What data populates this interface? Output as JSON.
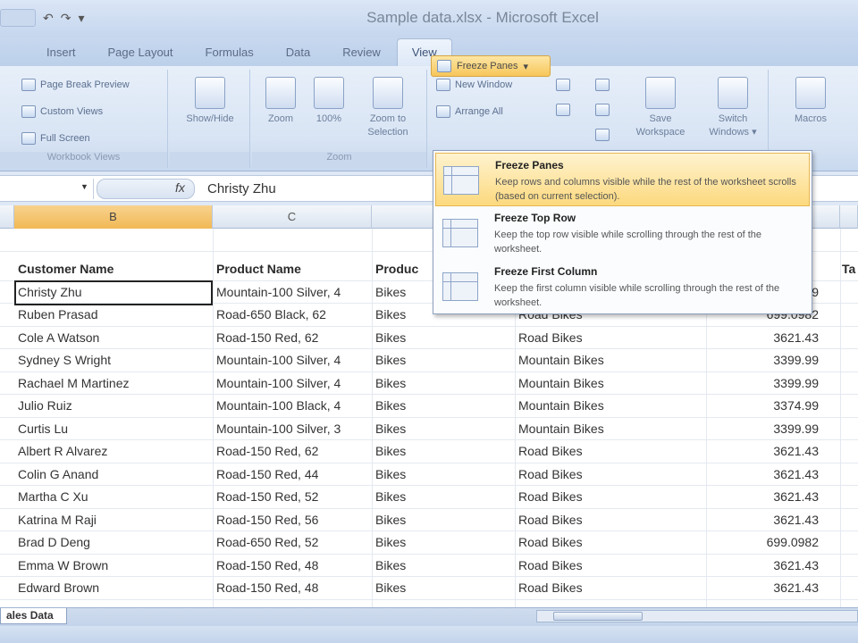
{
  "window": {
    "title": "Sample data.xlsx - Microsoft Excel"
  },
  "tabs": [
    {
      "label": "Insert"
    },
    {
      "label": "Page Layout"
    },
    {
      "label": "Formulas"
    },
    {
      "label": "Data"
    },
    {
      "label": "Review"
    },
    {
      "label": "View"
    }
  ],
  "ribbon": {
    "workbook_views": {
      "page_break": "Page Break Preview",
      "custom_views": "Custom Views",
      "full_screen": "Full Screen",
      "label": "Workbook Views"
    },
    "show_hide": "Show/Hide",
    "zoom": {
      "zoom": "Zoom",
      "hundred": "100%",
      "zoom_selection_1": "Zoom to",
      "zoom_selection_2": "Selection",
      "label": "Zoom"
    },
    "window": {
      "new_window": "New Window",
      "arrange_all": "Arrange All",
      "freeze_panes": "Freeze Panes",
      "save_workspace_1": "Save",
      "save_workspace_2": "Workspace",
      "switch_windows_1": "Switch",
      "switch_windows_2": "Windows"
    },
    "macros": "Macros"
  },
  "formula_bar": {
    "fx": "fx",
    "value": "Christy  Zhu"
  },
  "columns": [
    {
      "label": "B",
      "selected": true
    },
    {
      "label": "C",
      "selected": false
    }
  ],
  "table": {
    "headers": [
      "Customer Name",
      "Product Name",
      "Produc",
      "",
      "",
      "Ta"
    ],
    "rows": [
      [
        "Christy  Zhu",
        "Mountain-100 Silver, 4",
        "Bikes",
        "",
        "3399.99"
      ],
      [
        "Ruben  Prasad",
        "Road-650 Black, 62",
        "Bikes",
        "Road Bikes",
        "699.0982"
      ],
      [
        "Cole A Watson",
        "Road-150 Red, 62",
        "Bikes",
        "Road Bikes",
        "3621.43"
      ],
      [
        "Sydney S Wright",
        "Mountain-100 Silver, 4",
        "Bikes",
        "Mountain Bikes",
        "3399.99"
      ],
      [
        "Rachael M Martinez",
        "Mountain-100 Silver, 4",
        "Bikes",
        "Mountain Bikes",
        "3399.99"
      ],
      [
        "Julio  Ruiz",
        "Mountain-100 Black, 4",
        "Bikes",
        "Mountain Bikes",
        "3374.99"
      ],
      [
        "Curtis  Lu",
        "Mountain-100 Silver, 3",
        "Bikes",
        "Mountain Bikes",
        "3399.99"
      ],
      [
        "Albert R Alvarez",
        "Road-150 Red, 62",
        "Bikes",
        "Road Bikes",
        "3621.43"
      ],
      [
        "Colin G Anand",
        "Road-150 Red, 44",
        "Bikes",
        "Road Bikes",
        "3621.43"
      ],
      [
        "Martha C Xu",
        "Road-150 Red, 52",
        "Bikes",
        "Road Bikes",
        "3621.43"
      ],
      [
        "Katrina M Raji",
        "Road-150 Red, 56",
        "Bikes",
        "Road Bikes",
        "3621.43"
      ],
      [
        "Brad D Deng",
        "Road-650 Red, 52",
        "Bikes",
        "Road Bikes",
        "699.0982"
      ],
      [
        "Emma W Brown",
        "Road-150 Red, 48",
        "Bikes",
        "Road Bikes",
        "3621.43"
      ],
      [
        "Edward  Brown",
        "Road-150 Red, 48",
        "Bikes",
        "Road Bikes",
        "3621.43"
      ]
    ]
  },
  "dropdown": {
    "items": [
      {
        "title": "Freeze Panes",
        "desc": "Keep rows and columns visible while the rest of the worksheet scrolls (based on current selection)."
      },
      {
        "title": "Freeze Top Row",
        "desc": "Keep the top row visible while scrolling through the rest of the worksheet."
      },
      {
        "title": "Freeze First Column",
        "desc": "Keep the first column visible while scrolling through the rest of the worksheet."
      }
    ]
  },
  "sheet_tab": "ales Data",
  "colors": {
    "ribbon_bg": "#dfe8f5",
    "highlight": "#fcd97e",
    "selected_col": "#f1b955"
  }
}
